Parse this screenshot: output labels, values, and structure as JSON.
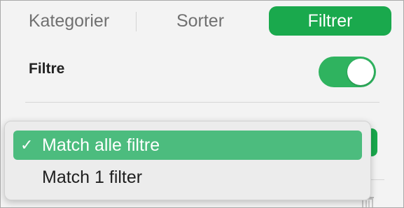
{
  "tabs": [
    {
      "label": "Kategorier",
      "selected": false
    },
    {
      "label": "Sorter",
      "selected": false
    },
    {
      "label": "Filtrer",
      "selected": true
    }
  ],
  "filters": {
    "title": "Filtre",
    "toggle_on": true
  },
  "match_menu": {
    "check_mark": "✓",
    "items": [
      {
        "label": "Match alle filtre",
        "selected": true
      },
      {
        "label": "Match 1 filter",
        "selected": false
      }
    ]
  },
  "colors": {
    "accent": "#1aa94d",
    "menu_highlight": "#4cbc7e",
    "toggle_on": "#2fb35f"
  },
  "icons": {
    "check": "checkmark-icon",
    "trash": "trash-icon"
  }
}
